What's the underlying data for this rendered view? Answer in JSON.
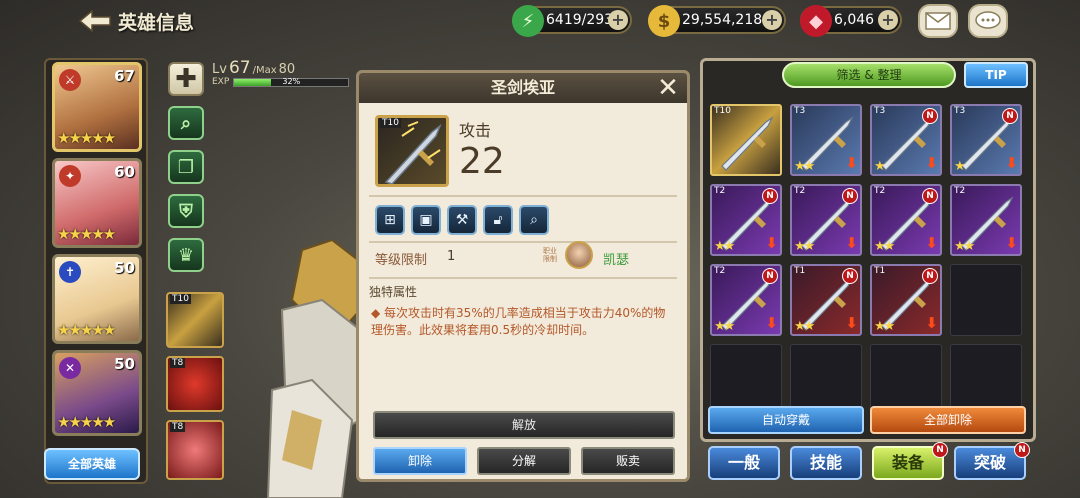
{
  "header": {
    "back_title": "英雄信息"
  },
  "resources": {
    "stamina": "6419/293",
    "gold": "29,554,218",
    "gems": "6,046"
  },
  "heroes": [
    {
      "level": "67",
      "stars": "★★★★★"
    },
    {
      "level": "60",
      "stars": "★★★★★"
    },
    {
      "level": "50",
      "stars": "★★★★★"
    },
    {
      "level": "50",
      "stars": "★★★★★"
    }
  ],
  "all_heroes_label": "全部英雄",
  "level_info": {
    "lv_prefix": "Lv",
    "level": "67",
    "max_prefix": "/Max",
    "max": "80",
    "exp_label": "EXP",
    "exp_percent": "32%",
    "exp_fraction": 0.32
  },
  "equipped_thumbs": [
    {
      "tier": "T10"
    },
    {
      "tier": "T8"
    },
    {
      "tier": "T8"
    }
  ],
  "item": {
    "name": "圣剑埃亚",
    "tier": "T10",
    "stat_label": "攻击",
    "stat_value": "22",
    "level_limit_label": "等级限制",
    "level_limit_value": "1",
    "class_label": "职业限制",
    "class_name": "凯瑟",
    "section_title": "独特属性",
    "description": "◆ 每次攻击时有35%的几率造成相当于攻击力40%的物理伤害。此效果将套用0.5秒的冷却时间。",
    "release_label": "解放",
    "buttons": {
      "unequip": "卸除",
      "dismantle": "分解",
      "sell": "贩卖"
    }
  },
  "inventory": {
    "filter_label": "筛选 & 整理",
    "tip_label": "TIP",
    "items": [
      {
        "tier": "T10",
        "stars": "",
        "new": false,
        "down": false
      },
      {
        "tier": "T3",
        "stars": "★★",
        "new": false,
        "down": true
      },
      {
        "tier": "T3",
        "stars": "★",
        "new": true,
        "down": true
      },
      {
        "tier": "T3",
        "stars": "★",
        "new": true,
        "down": true
      },
      {
        "tier": "T2",
        "stars": "★★",
        "new": true,
        "down": true
      },
      {
        "tier": "T2",
        "stars": "★★",
        "new": true,
        "down": true
      },
      {
        "tier": "T2",
        "stars": "★★",
        "new": true,
        "down": true
      },
      {
        "tier": "T2",
        "stars": "★★",
        "new": false,
        "down": true
      },
      {
        "tier": "T2",
        "stars": "★★",
        "new": true,
        "down": true
      },
      {
        "tier": "T1",
        "stars": "★★",
        "new": true,
        "down": true
      },
      {
        "tier": "T1",
        "stars": "★★",
        "new": true,
        "down": true
      }
    ],
    "new_badge": "N",
    "auto_equip": "自动穿戴",
    "unequip_all": "全部卸除"
  },
  "tabs": [
    {
      "label": "一般",
      "active": false,
      "new": false
    },
    {
      "label": "技能",
      "active": false,
      "new": false
    },
    {
      "label": "装备",
      "active": true,
      "new": true
    },
    {
      "label": "突破",
      "active": false,
      "new": true
    }
  ]
}
